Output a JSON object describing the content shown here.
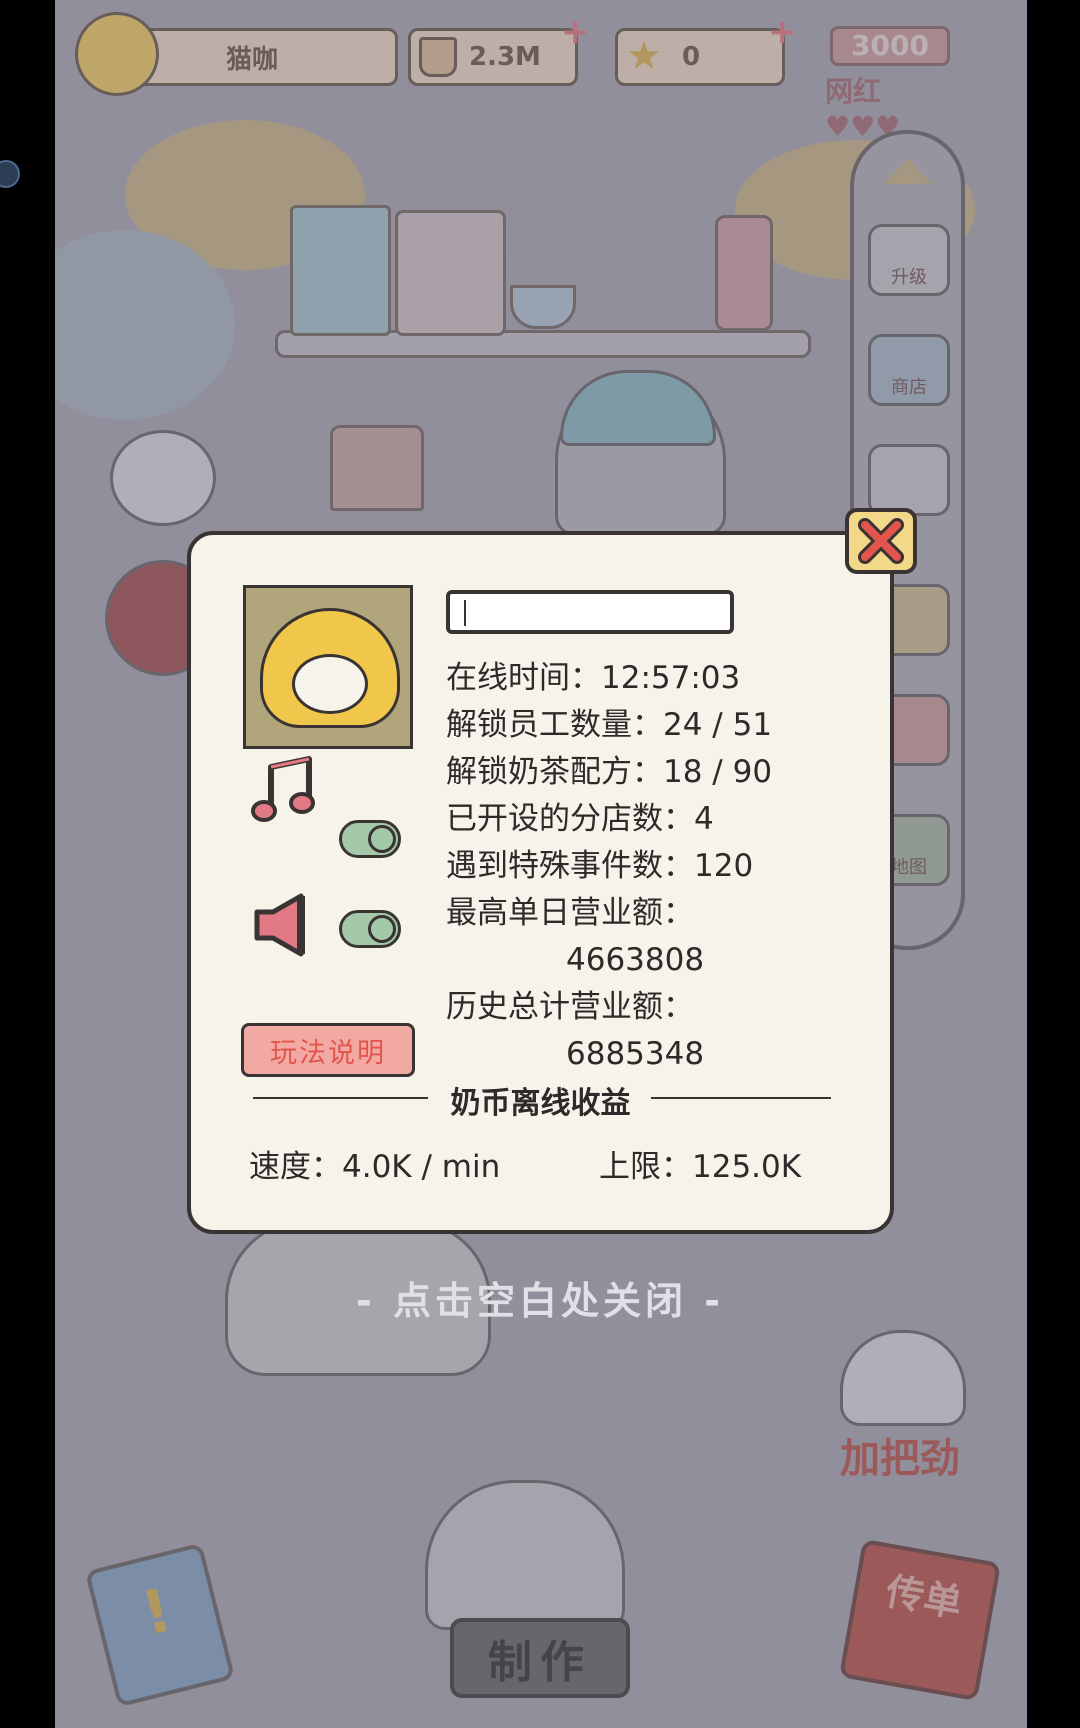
{
  "top_bar": {
    "player_name": "猫咖",
    "tea_amount": "2.3M",
    "star_amount": "0",
    "fame_value": "3000",
    "fame_label": "网红"
  },
  "side_menu": {
    "items": [
      "升级",
      "商店",
      "",
      "",
      "",
      "地图"
    ]
  },
  "profile_panel": {
    "name_value": "",
    "stats": {
      "online_time": "在线时间：12:57:03",
      "staff_unlocked": "解锁员工数量：24 / 51",
      "recipes_unlocked": "解锁奶茶配方：18 / 90",
      "branches": "已开设的分店数：4",
      "special_events": "遇到特殊事件数：120",
      "best_day_label": "最高单日营业额：",
      "best_day_value": "4663808",
      "total_label": "历史总计营业额：",
      "total_value": "6885348"
    },
    "music_on": true,
    "sound_on": true,
    "help_label": "玩法说明",
    "offline": {
      "title": "奶币离线收益",
      "speed": "速度：4.0K / min",
      "limit": "上限：125.0K"
    }
  },
  "tap_to_close": "- 点击空白处关闭 -",
  "bottom": {
    "cheer_label": "加把劲",
    "make_label": "制作",
    "flyer_label": "传单"
  },
  "colors": {
    "panel_bg": "#f5f3ea",
    "outline": "#3a3333",
    "close_bg": "#f4d88a",
    "close_x": "#e2554c",
    "help_bg": "#f2a9a3",
    "toggle_on": "#a3c9a8",
    "note": "#e27a85"
  },
  "icons": [
    "music-note-icon",
    "speaker-icon",
    "close-icon",
    "milk-tea-icon",
    "star-icon",
    "heart-icon",
    "book-icon"
  ]
}
